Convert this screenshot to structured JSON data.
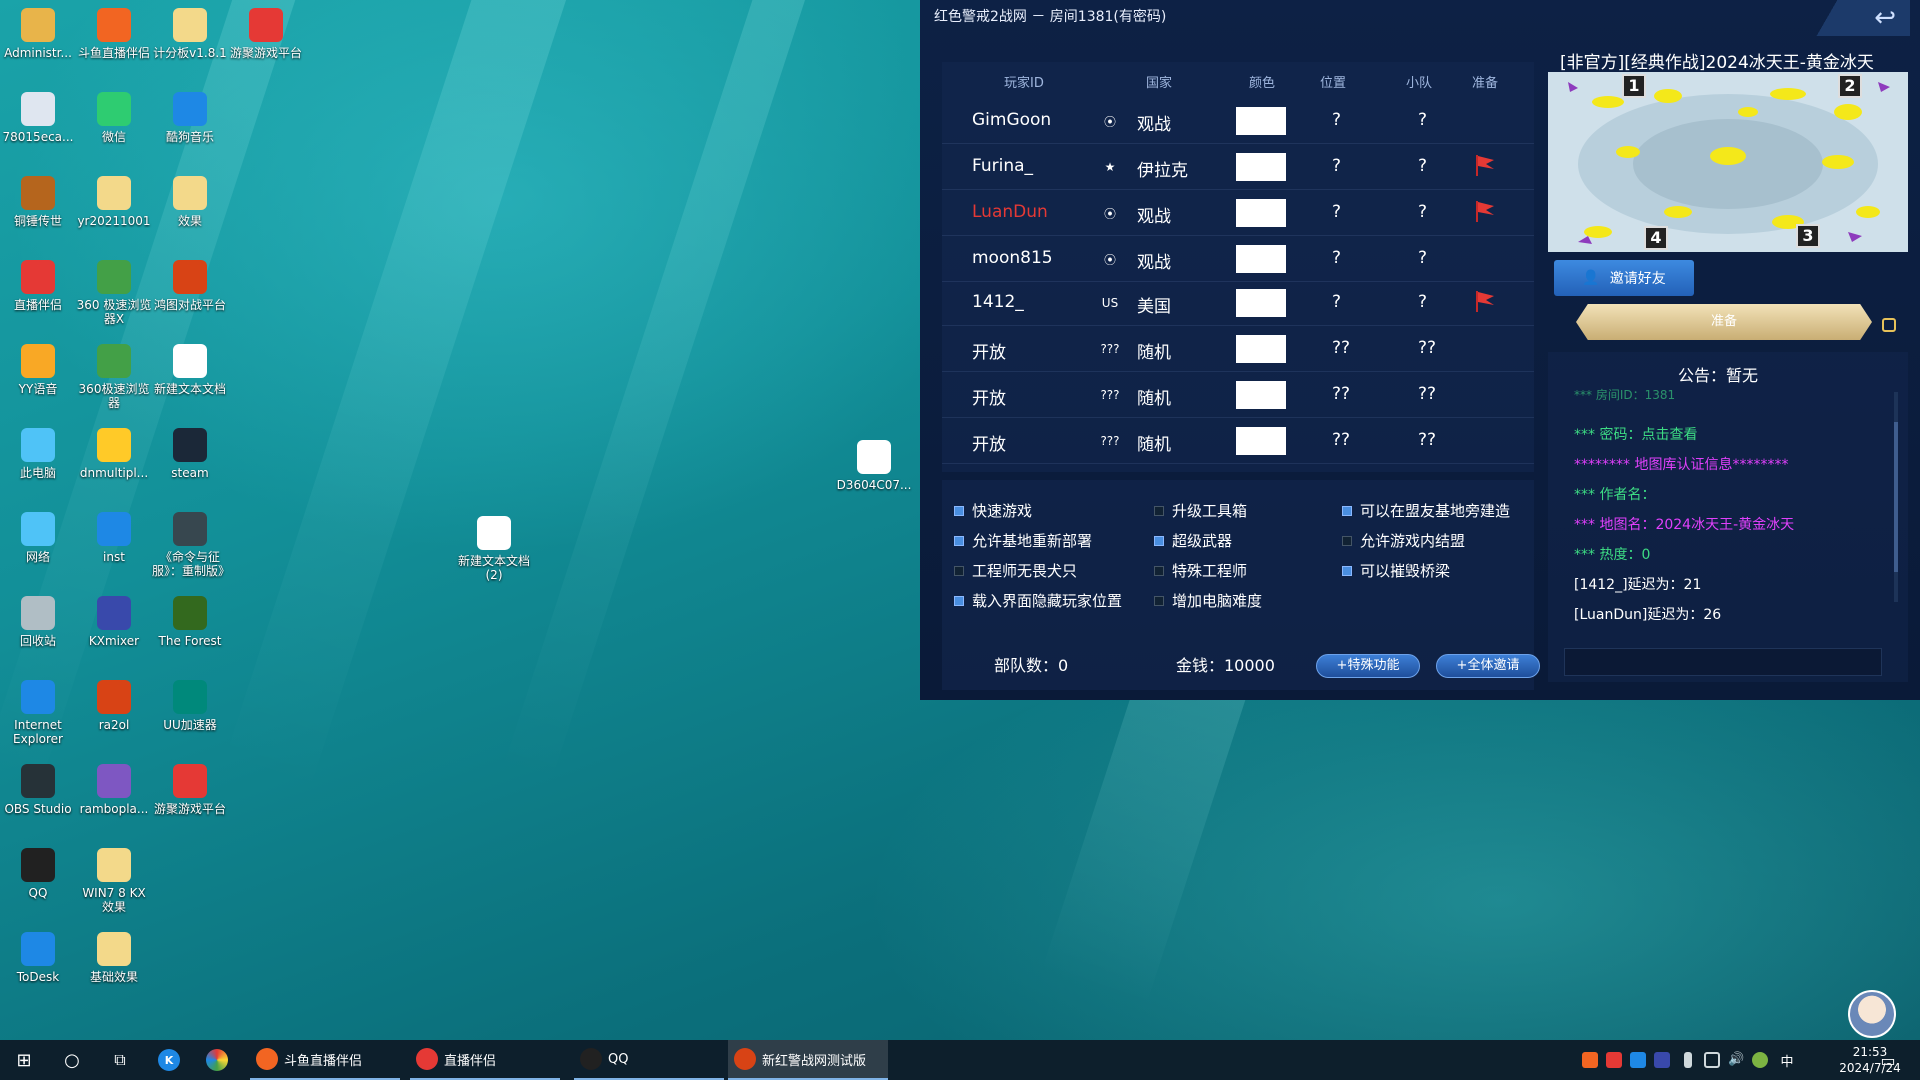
{
  "desktop": {
    "icons": [
      {
        "label": "Administr...",
        "color": "#e8b44a"
      },
      {
        "label": "斗鱼直播伴侣",
        "color": "#f26522"
      },
      {
        "label": "计分板v1.8.1",
        "color": "#f3d98a"
      },
      {
        "label": "游聚游戏平台",
        "color": "#e53935"
      },
      {
        "label": "78015eca...",
        "color": "#dfe6f0"
      },
      {
        "label": "微信",
        "color": "#2ecc71"
      },
      {
        "label": "酷狗音乐",
        "color": "#1e88e5"
      },
      {
        "label": "铜锤传世",
        "color": "#b5651d"
      },
      {
        "label": "yr20211001",
        "color": "#f3d98a"
      },
      {
        "label": "效果",
        "color": "#f3d98a"
      },
      {
        "label": "直播伴侣",
        "color": "#e53935"
      },
      {
        "label": "360 极速浏览器X",
        "color": "#43a047"
      },
      {
        "label": "鸿图对战平台",
        "color": "#d84315"
      },
      {
        "label": "YY语音",
        "color": "#f9a825"
      },
      {
        "label": "360极速浏览器",
        "color": "#43a047"
      },
      {
        "label": "新建文本文档",
        "color": "#ffffff"
      },
      {
        "label": "此电脑",
        "color": "#4fc3f7"
      },
      {
        "label": "dnmultipl...",
        "color": "#ffca28"
      },
      {
        "label": "steam",
        "color": "#1b2838"
      },
      {
        "label": "网络",
        "color": "#4fc3f7"
      },
      {
        "label": "inst",
        "color": "#1e88e5"
      },
      {
        "label": "《命令与征服》：重制版》",
        "color": "#37474f"
      },
      {
        "label": "回收站",
        "color": "#b0bec5"
      },
      {
        "label": "KXmixer",
        "color": "#3949ab"
      },
      {
        "label": "The Forest",
        "color": "#33691e"
      },
      {
        "label": "Internet Explorer",
        "color": "#1e88e5"
      },
      {
        "label": "ra2ol",
        "color": "#d84315"
      },
      {
        "label": "UU加速器",
        "color": "#00897b"
      },
      {
        "label": "OBS Studio",
        "color": "#263238"
      },
      {
        "label": "rambopla...",
        "color": "#7e57c2"
      },
      {
        "label": "游聚游戏平台",
        "color": "#e53935"
      },
      {
        "label": "QQ",
        "color": "#212121"
      },
      {
        "label": "WIN7 8 KX 效果",
        "color": "#f3d98a"
      },
      {
        "label": "ToDesk",
        "color": "#1e88e5"
      },
      {
        "label": "基础效果",
        "color": "#f3d98a"
      },
      {
        "label": "D3604C07...",
        "color": "#ffffff"
      },
      {
        "label": "新建文本文档 (2)",
        "color": "#ffffff"
      }
    ]
  },
  "window": {
    "title": "红色警戒2战网 － 房间1381(有密码)",
    "back_icon": "↩"
  },
  "table": {
    "headers": [
      "玩家ID",
      "国家",
      "颜色",
      "位置",
      "小队",
      "准备"
    ],
    "rows": [
      {
        "id": "GimGoon",
        "id_color": "#ffffff",
        "flag": "⦿",
        "country": "观战",
        "pos": "?",
        "team": "?",
        "ready": false
      },
      {
        "id": "Furina_",
        "id_color": "#ffffff",
        "flag": "★",
        "country": "伊拉克",
        "pos": "?",
        "team": "?",
        "ready": true
      },
      {
        "id": "LuanDun",
        "id_color": "#e53935",
        "flag": "⦿",
        "country": "观战",
        "pos": "?",
        "team": "?",
        "ready": true
      },
      {
        "id": "moon815",
        "id_color": "#ffffff",
        "flag": "⦿",
        "country": "观战",
        "pos": "?",
        "team": "?",
        "ready": false
      },
      {
        "id": "1412_",
        "id_color": "#ffffff",
        "flag": "US",
        "country": "美国",
        "pos": "?",
        "team": "?",
        "ready": true
      },
      {
        "id": "开放",
        "id_color": "#ffffff",
        "flag": "???",
        "country": "随机",
        "pos": "??",
        "team": "??",
        "ready": false
      },
      {
        "id": "开放",
        "id_color": "#ffffff",
        "flag": "???",
        "country": "随机",
        "pos": "??",
        "team": "??",
        "ready": false
      },
      {
        "id": "开放",
        "id_color": "#ffffff",
        "flag": "???",
        "country": "随机",
        "pos": "??",
        "team": "??",
        "ready": false
      }
    ]
  },
  "options": [
    {
      "label": "快速游戏",
      "checked": true
    },
    {
      "label": "升级工具箱",
      "checked": false
    },
    {
      "label": "可以在盟友基地旁建造",
      "checked": true
    },
    {
      "label": "允许基地重新部署",
      "checked": true
    },
    {
      "label": "超级武器",
      "checked": true
    },
    {
      "label": "允许游戏内结盟",
      "checked": false
    },
    {
      "label": "工程师无畏犬只",
      "checked": false
    },
    {
      "label": "特殊工程师",
      "checked": false
    },
    {
      "label": "可以摧毁桥梁",
      "checked": true
    },
    {
      "label": "载入界面隐藏玩家位置",
      "checked": true
    },
    {
      "label": "增加电脑难度",
      "checked": false
    }
  ],
  "stats": {
    "units": "部队数：0",
    "money": "金钱：10000",
    "special_btn": "+特殊功能",
    "invite_all_btn": "+全体邀请"
  },
  "map": {
    "title": "[非官方][经典作战]2024冰天王-黄金冰天",
    "starts": [
      "1",
      "2",
      "4",
      "3"
    ]
  },
  "invite_btn": "邀请好友",
  "ready_btn": "准备",
  "notice": {
    "title": "公告：暂无",
    "lines": [
      {
        "text": "*** 房间ID：1381",
        "color": "#3ddc84"
      },
      {
        "text": "*** 密码：点击查看",
        "color": "#3ddc84"
      },
      {
        "text": "******** 地图库认证信息********",
        "color": "#e040fb"
      },
      {
        "text": "*** 作者名：",
        "color": "#3ddc84"
      },
      {
        "text": "*** 地图名：2024冰天王-黄金冰天",
        "color": "#e040fb"
      },
      {
        "text": "*** 热度：0",
        "color": "#3ddc84"
      },
      {
        "text": "[1412_]延迟为：21",
        "color": "#ffffff"
      },
      {
        "text": "[LuanDun]延迟为：26",
        "color": "#ffffff"
      }
    ]
  },
  "taskbar": {
    "apps": [
      {
        "label": "斗鱼直播伴侣",
        "color": "#f26522"
      },
      {
        "label": "直播伴侣",
        "color": "#e53935"
      },
      {
        "label": "QQ",
        "color": "#212121"
      },
      {
        "label": "新红警战网测试版",
        "color": "#d84315"
      }
    ],
    "ime": "中",
    "time": "21:53",
    "date": "2024/7/24"
  }
}
